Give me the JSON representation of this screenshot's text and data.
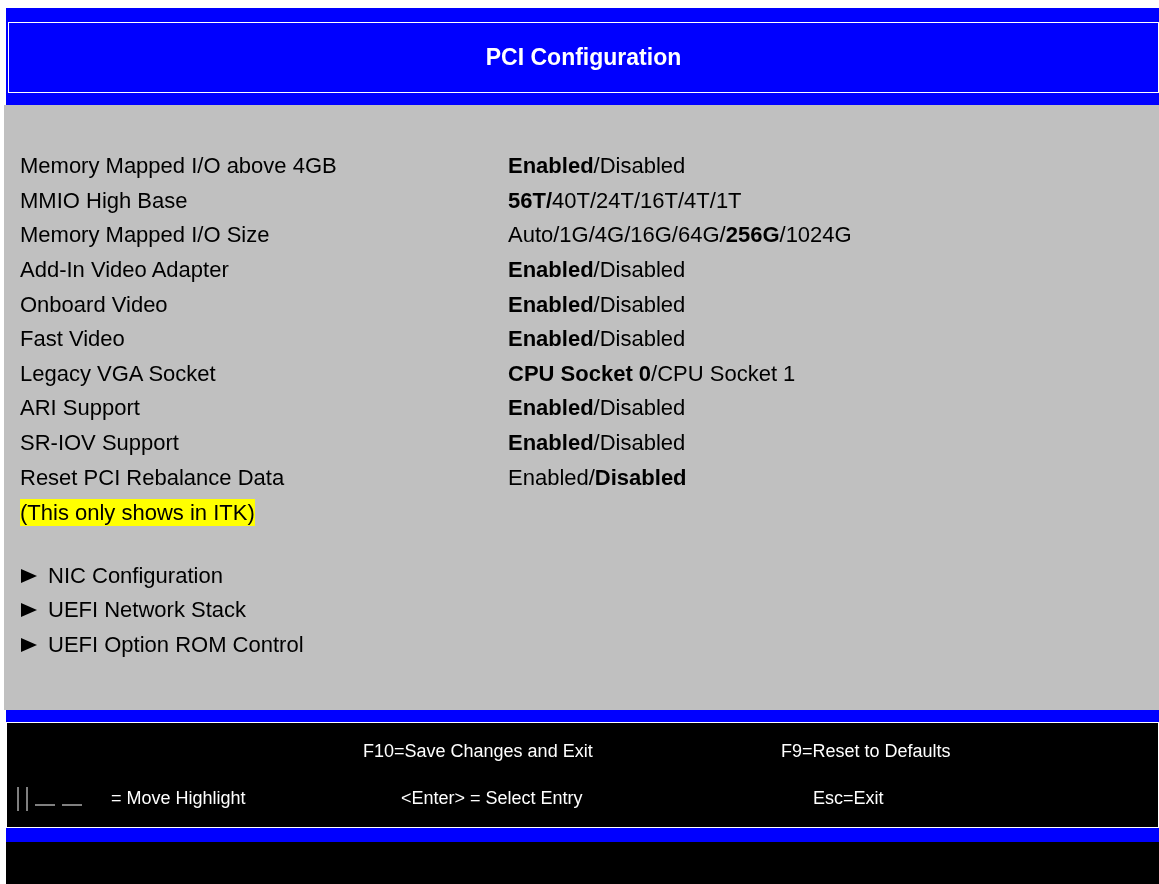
{
  "title": "PCI Configuration",
  "settings": [
    {
      "label": "Memory Mapped I/O above 4GB",
      "value": "**Enabled**/Disabled"
    },
    {
      "label": "MMIO High Base",
      "value": "**56T/**40T/24T/16T/4T/1T"
    },
    {
      "label": "Memory Mapped I/O Size",
      "value": "Auto/1G/4G/16G/64G/**256G**/1024G"
    },
    {
      "label": "Add-In Video Adapter",
      "value": "**Enabled**/Disabled"
    },
    {
      "label": "Onboard Video",
      "value": "**Enabled**/Disabled"
    },
    {
      "label": "Fast Video",
      "value": "**Enabled**/Disabled"
    },
    {
      "label": "Legacy VGA Socket",
      "value": "**CPU Socket 0**/CPU Socket 1"
    },
    {
      "label": "ARI Support",
      "value": "**Enabled**/Disabled"
    },
    {
      "label": "SR-IOV Support",
      "value": "**Enabled**/Disabled"
    },
    {
      "label": "Reset PCI Rebalance Data",
      "value": "Enabled/**Disabled**"
    }
  ],
  "note": "(This only shows in ITK)",
  "submenus": [
    "NIC Configuration",
    "UEFI Network Stack",
    "UEFI Option ROM Control"
  ],
  "footer": {
    "save": "F10=Save Changes and Exit",
    "reset": "F9=Reset to Defaults",
    "move": "= Move Highlight",
    "select": "<Enter> = Select Entry",
    "exit": "Esc=Exit"
  }
}
